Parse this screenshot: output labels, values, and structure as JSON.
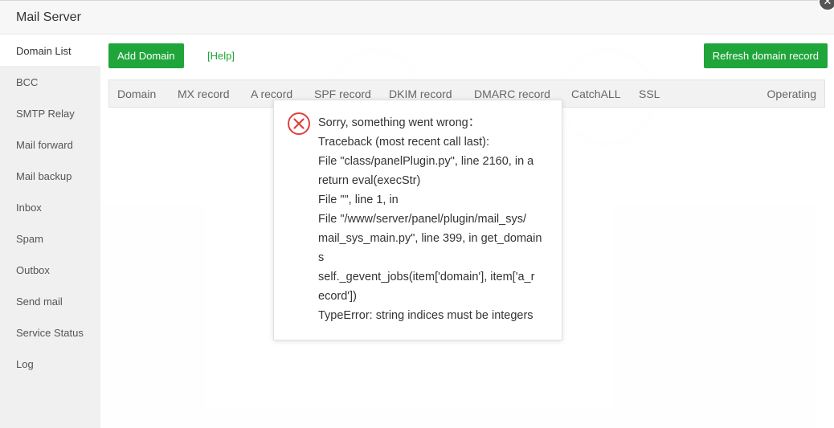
{
  "window": {
    "title": "Mail Server",
    "close_symbol": "✕"
  },
  "sidebar": {
    "items": [
      {
        "label": "Domain List",
        "active": true
      },
      {
        "label": "BCC"
      },
      {
        "label": "SMTP Relay"
      },
      {
        "label": "Mail forward"
      },
      {
        "label": "Mail backup"
      },
      {
        "label": "Inbox"
      },
      {
        "label": "Spam"
      },
      {
        "label": "Outbox"
      },
      {
        "label": "Send mail"
      },
      {
        "label": "Service Status"
      },
      {
        "label": "Log"
      }
    ]
  },
  "toolbar": {
    "add_domain_label": "Add Domain",
    "help_label": "[Help]",
    "refresh_label": "Refresh domain record"
  },
  "table": {
    "columns": [
      "Domain",
      "MX record",
      "A record",
      "SPF record",
      "DKIM record",
      "DMARC record",
      "CatchALL",
      "SSL",
      "Operating"
    ]
  },
  "dialog": {
    "lines": [
      "Sorry, something went wrong：",
      "Traceback (most recent call last):",
      "File \"class/panelPlugin.py\", line 2160, in a",
      "return eval(execStr)",
      "File \"\", line 1, in",
      "File \"/www/server/panel/plugin/mail_sys/",
      "mail_sys_main.py\", line 399, in get_domain",
      "s",
      "self._gevent_jobs(item['domain'], item['a_r",
      "ecord'])",
      "TypeError: string indices must be integers"
    ]
  },
  "colors": {
    "accent": "#20a53a",
    "error": "#e0403c"
  }
}
